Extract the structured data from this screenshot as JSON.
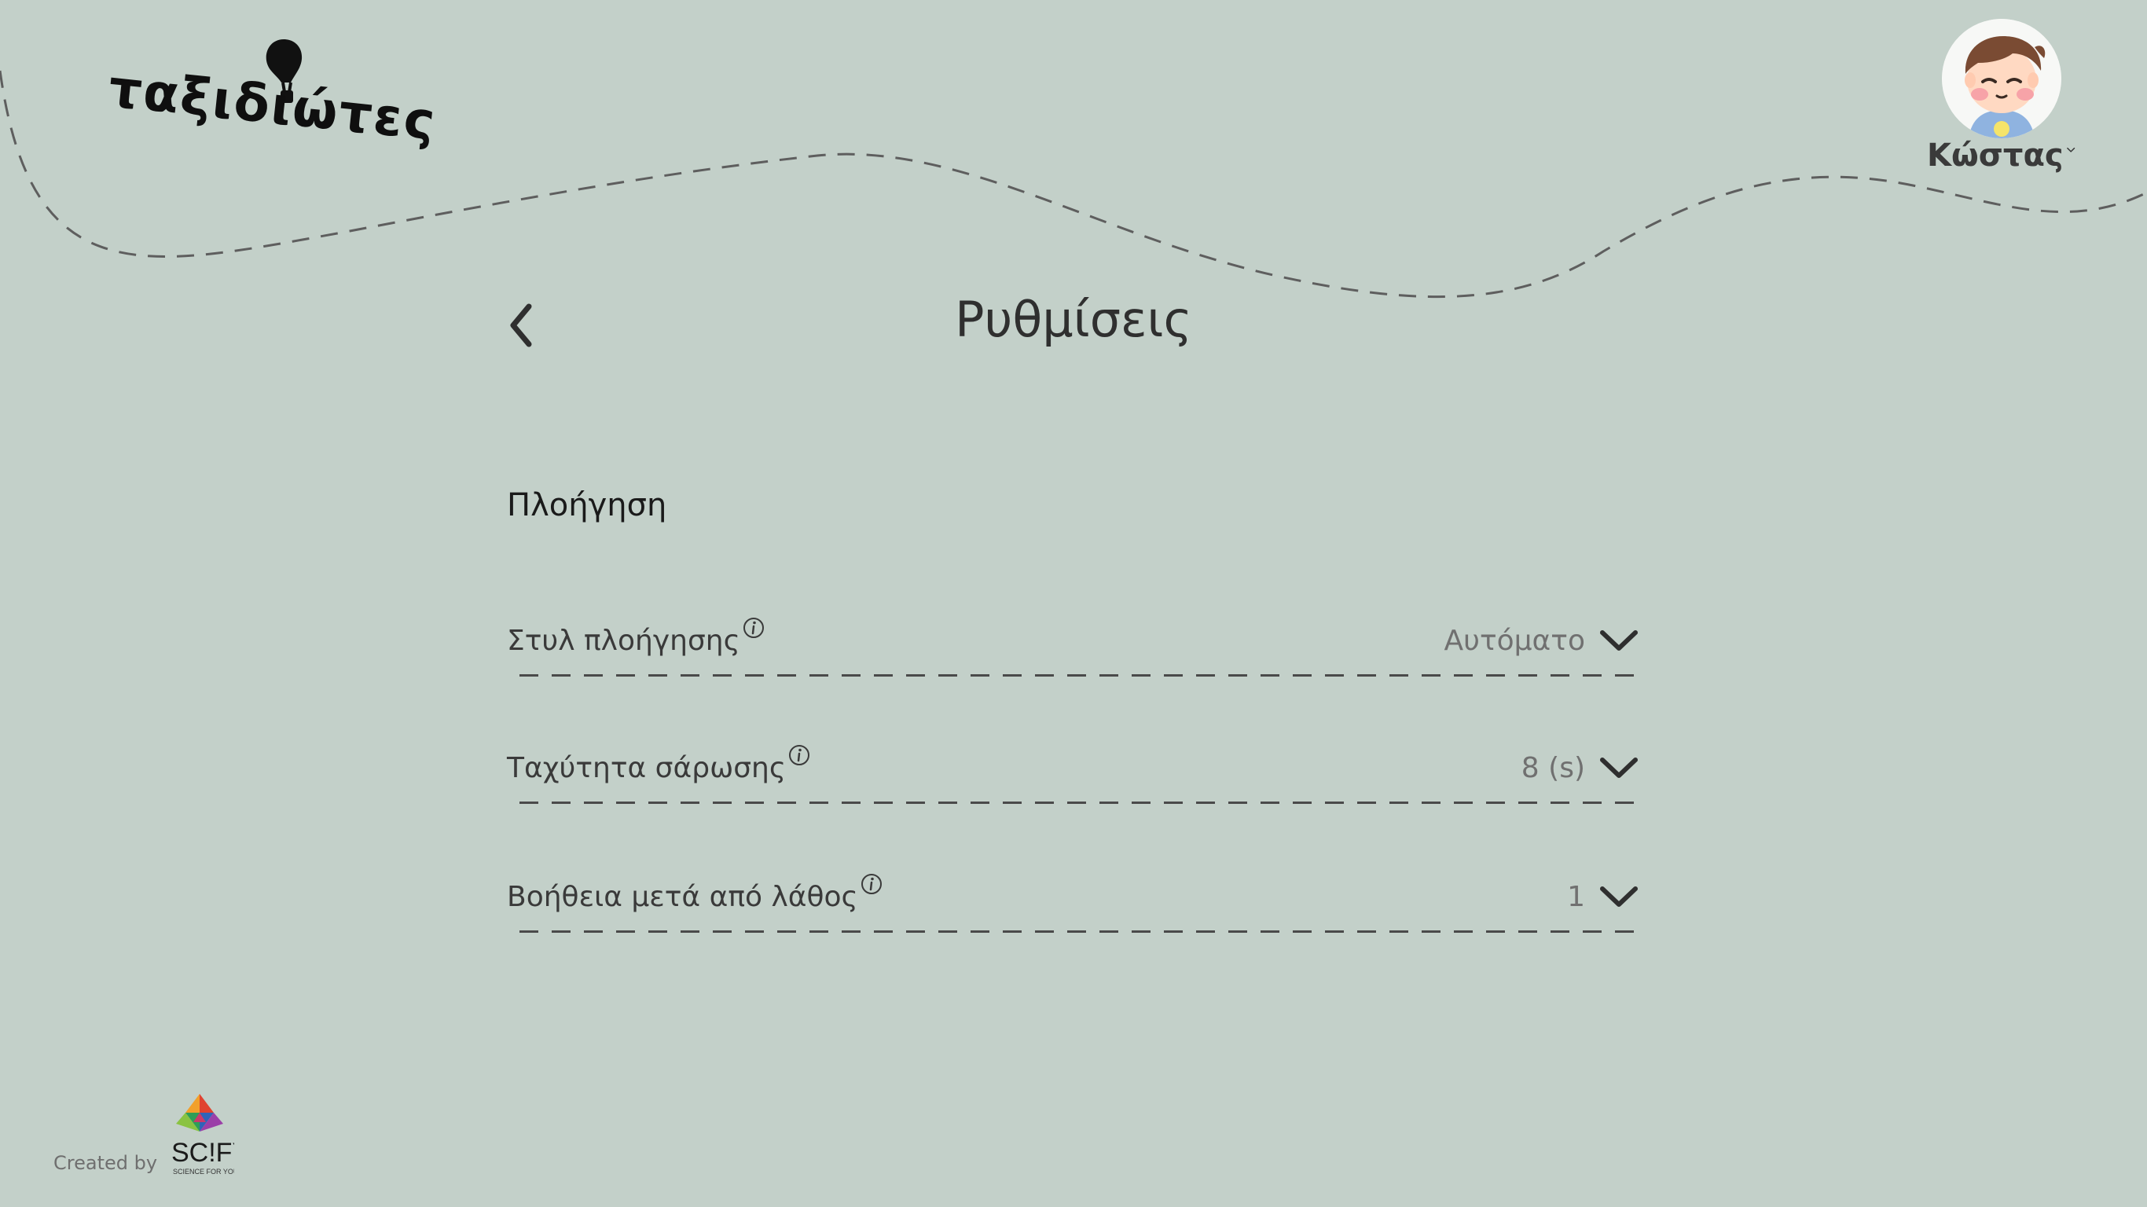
{
  "app": {
    "logo_text": "ταξιδιώτες"
  },
  "user": {
    "name": "Κώστας"
  },
  "header": {
    "title": "Ρυθμίσεις"
  },
  "section": {
    "title": "Πλοήγηση"
  },
  "settings": [
    {
      "label": "Στυλ πλοήγησης",
      "value": "Αυτόματο"
    },
    {
      "label": "Ταχύτητα σάρωσης",
      "value": "8 (s)"
    },
    {
      "label": "Βοήθεια μετά από λάθος",
      "value": "1"
    }
  ],
  "footer": {
    "created_by": "Created by",
    "brand": "SC!FY",
    "brand_tagline": "SCIENCE FOR YOU"
  },
  "colors": {
    "background": "#c3d0c9",
    "text": "#2f2f2f",
    "muted_text": "#707070",
    "divider": "#4a4a4a"
  },
  "icons": {
    "back": "chevron-left-icon",
    "dropdown": "chevron-down-icon",
    "info": "info-icon",
    "balloon": "hot-air-balloon-icon",
    "avatar": "boy-avatar-icon"
  }
}
